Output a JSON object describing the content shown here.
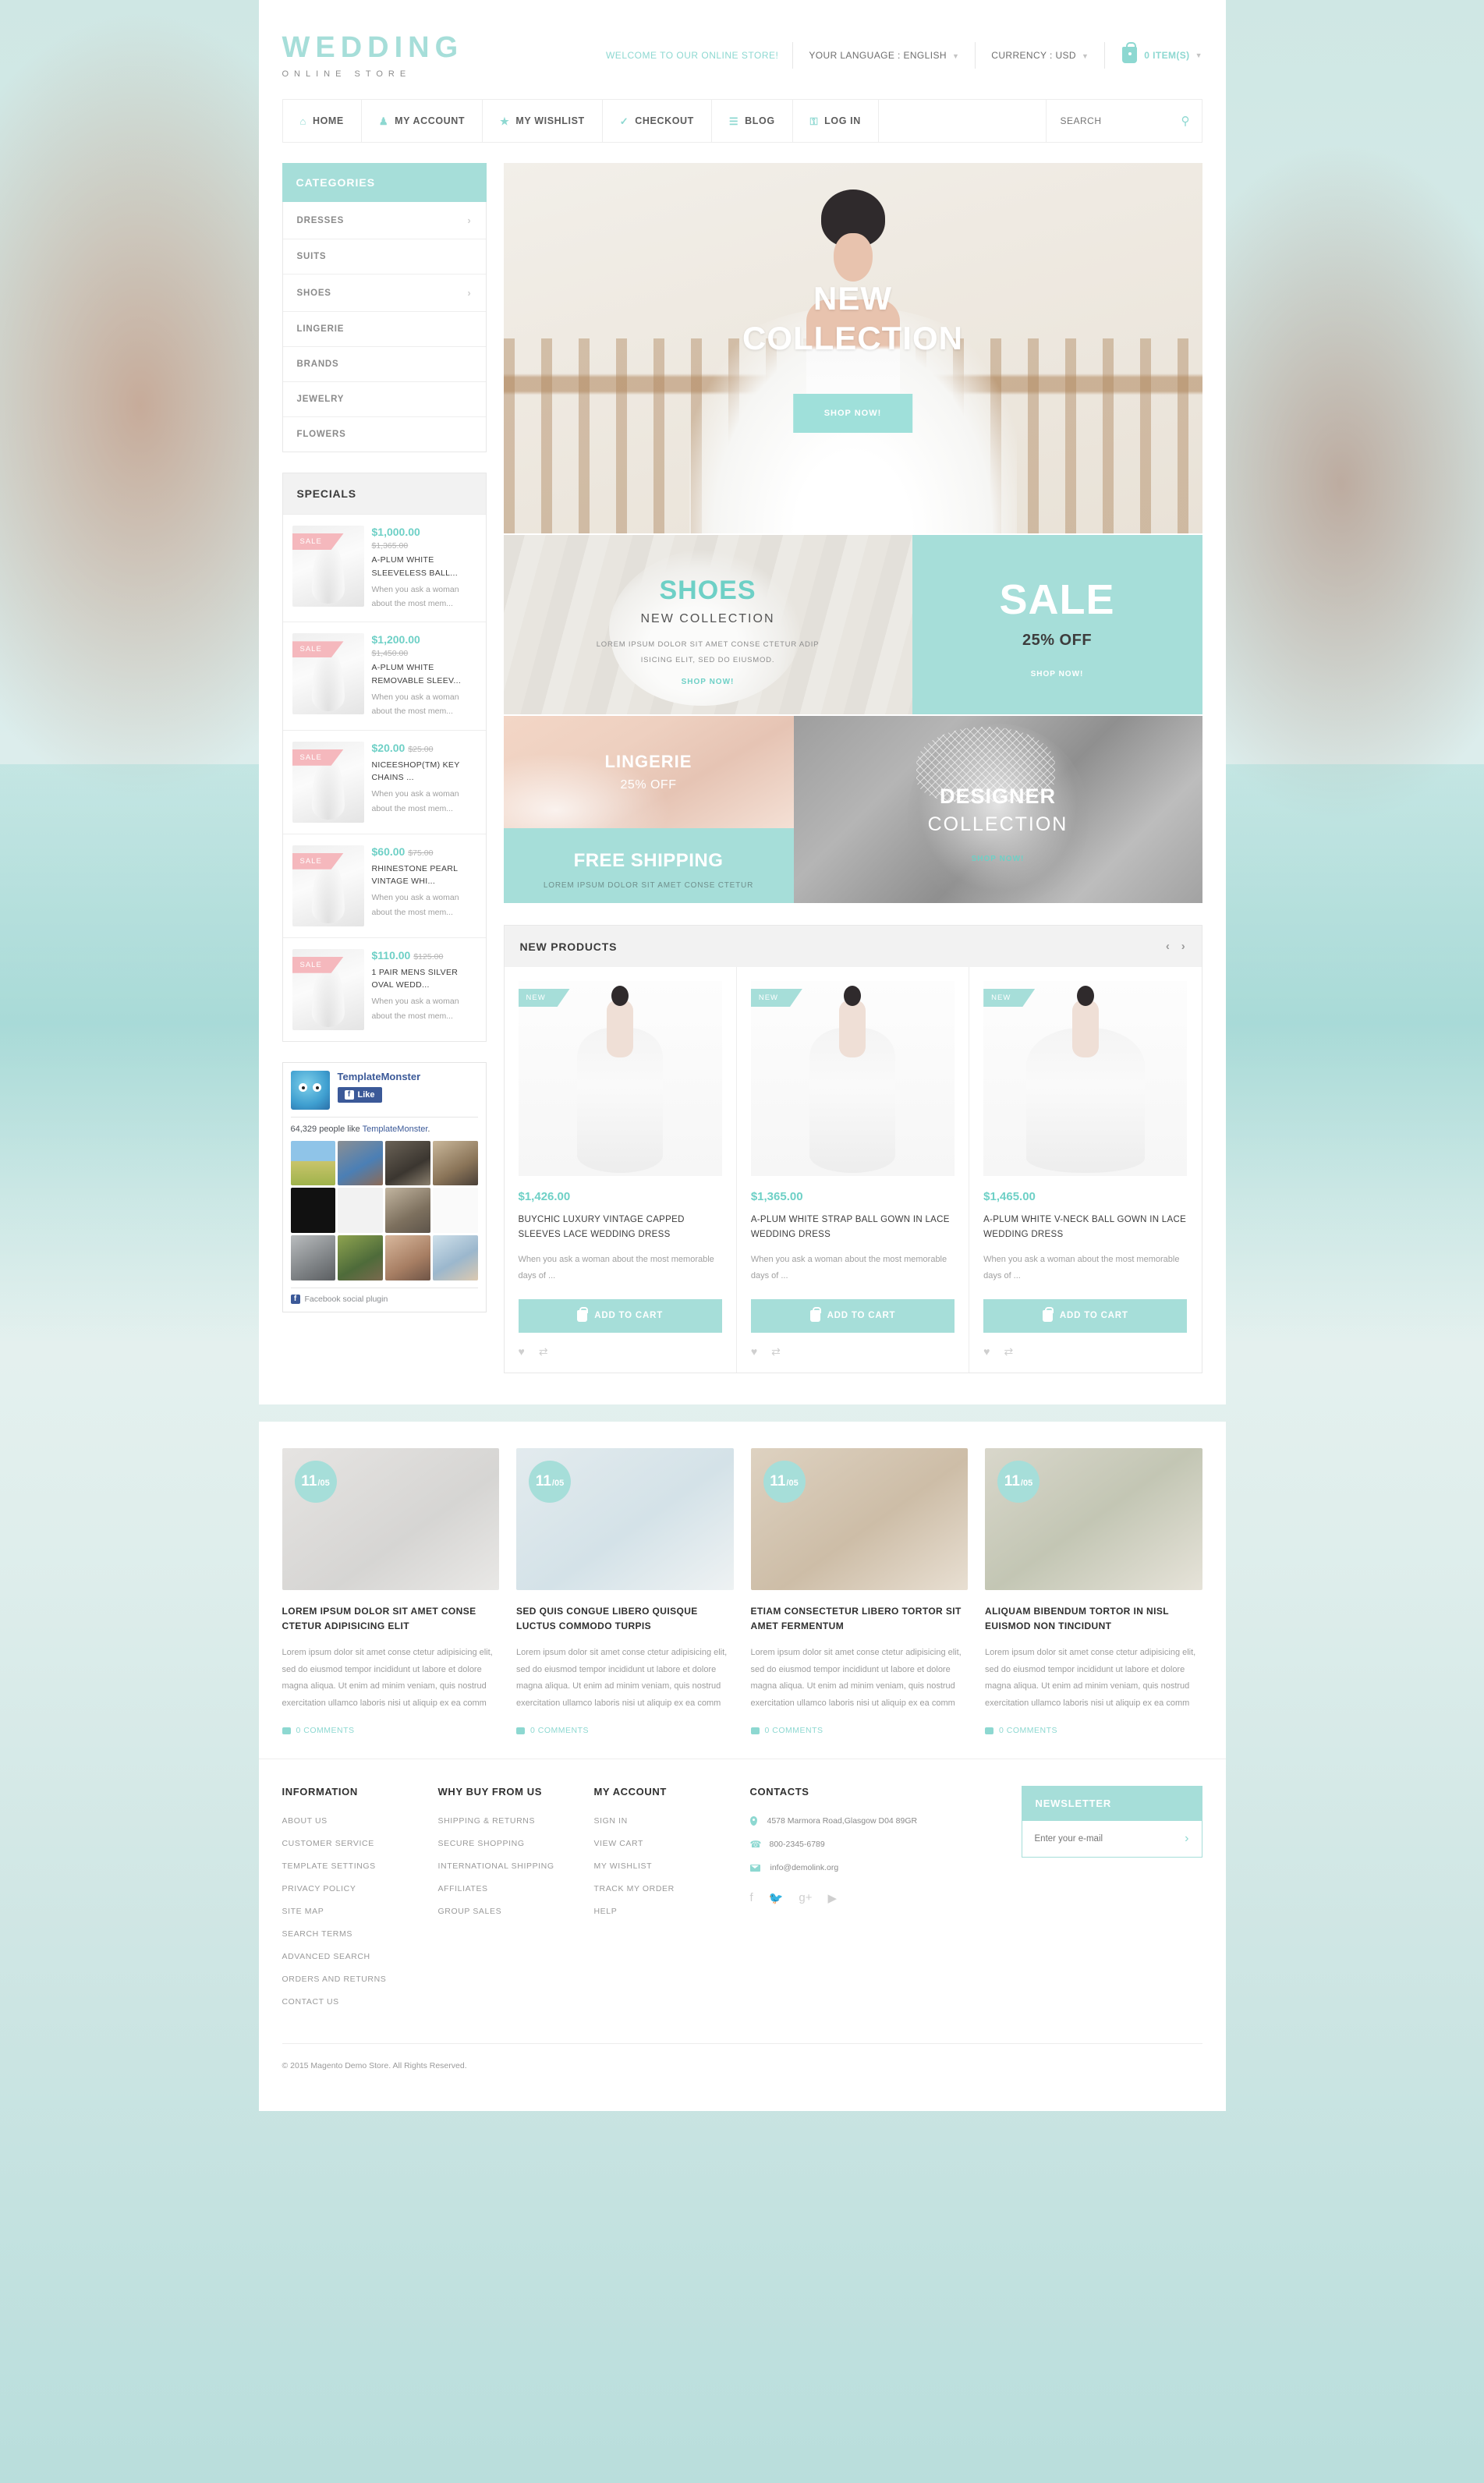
{
  "header": {
    "logo_main": "WEDDING",
    "logo_sub": "ONLINE STORE",
    "welcome": "WELCOME TO OUR ONLINE STORE!",
    "language": "YOUR LANGUAGE : ENGLISH",
    "currency": "CURRENCY : USD",
    "cart": "0 ITEM(S)"
  },
  "nav": {
    "items": [
      {
        "label": "HOME",
        "icon": "home-icon",
        "glyph": "⌂"
      },
      {
        "label": "MY ACCOUNT",
        "icon": "user-icon",
        "glyph": "♟"
      },
      {
        "label": "MY WISHLIST",
        "icon": "star-icon",
        "glyph": "★"
      },
      {
        "label": "CHECKOUT",
        "icon": "check-circle-icon",
        "glyph": "✓"
      },
      {
        "label": "BLOG",
        "icon": "document-icon",
        "glyph": "☰"
      },
      {
        "label": "LOG IN",
        "icon": "lock-icon",
        "glyph": "⚿"
      }
    ],
    "search_placeholder": "SEARCH",
    "search_value": ""
  },
  "sidebar": {
    "categories_title": "CATEGORIES",
    "categories": [
      {
        "label": "DRESSES",
        "has_arrow": true
      },
      {
        "label": "SUITS",
        "has_arrow": false
      },
      {
        "label": "SHOES",
        "has_arrow": true
      },
      {
        "label": "LINGERIE",
        "has_arrow": false
      },
      {
        "label": "BRANDS",
        "has_arrow": false
      },
      {
        "label": "JEWELRY",
        "has_arrow": false
      },
      {
        "label": "FLOWERS",
        "has_arrow": false
      }
    ],
    "specials_title": "SPECIALS",
    "specials_badge": "SALE",
    "specials": [
      {
        "price": "$1,000.00",
        "old_price": "$1,365.00",
        "price_stacked": true,
        "name": "A-PLUM WHITE SLEEVELESS BALL...",
        "desc": "When you ask a woman about the most mem..."
      },
      {
        "price": "$1,200.00",
        "old_price": "$1,450.00",
        "price_stacked": true,
        "name": "A-PLUM WHITE REMOVABLE SLEEV...",
        "desc": "When you ask a woman about the most mem..."
      },
      {
        "price": "$20.00",
        "old_price": "$25.00",
        "price_stacked": false,
        "name": "NICEESHOP(TM) KEY CHAINS ...",
        "desc": "When you ask a woman about the most mem..."
      },
      {
        "price": "$60.00",
        "old_price": "$75.00",
        "price_stacked": false,
        "name": "RHINESTONE PEARL VINTAGE WHI...",
        "desc": "When you ask a woman about the most mem..."
      },
      {
        "price": "$110.00",
        "old_price": "$125.00",
        "price_stacked": false,
        "name": "1 PAIR MENS SILVER OVAL WEDD...",
        "desc": "When you ask a woman about the most mem..."
      }
    ],
    "facebook": {
      "page_name": "TemplateMonster",
      "like_label": "Like",
      "count_text": "64,329 people like ",
      "count_link": "TemplateMonster",
      "count_end": ".",
      "plugin_label": "Facebook social plugin"
    }
  },
  "hero": {
    "line1": "NEW",
    "line2": "COLLECTION",
    "button": "SHOP NOW!"
  },
  "promos": {
    "shoes": {
      "title": "SHOES",
      "subtitle": "NEW COLLECTION",
      "desc_line1": "LOREM IPSUM DOLOR SIT AMET CONSE CTETUR ADIP",
      "desc_line2": "ISICING ELIT, SED DO EIUSMOD.",
      "link": "SHOP NOW!"
    },
    "sale": {
      "title": "SALE",
      "subtitle": "25% OFF",
      "link": "SHOP NOW!"
    },
    "lingerie": {
      "title": "LINGERIE",
      "subtitle": "25% OFF"
    },
    "shipping": {
      "title": "FREE SHIPPING",
      "subtitle": "LOREM IPSUM DOLOR SIT AMET CONSE CTETUR"
    },
    "designer": {
      "line1": "DESIGNER",
      "line2": "COLLECTION",
      "link": "SHOP NOW!"
    }
  },
  "new_products": {
    "title": "NEW PRODUCTS",
    "badge": "NEW",
    "add_to_cart": "ADD TO CART",
    "items": [
      {
        "price": "$1,426.00",
        "name": "BUYCHIC LUXURY VINTAGE CAPPED SLEEVES LACE WEDDING DRESS",
        "desc": "When you ask a woman about the most memorable days of ..."
      },
      {
        "price": "$1,365.00",
        "name": "A-PLUM WHITE STRAP BALL GOWN IN LACE WEDDING DRESS",
        "desc": "When you ask a woman about the most memorable days of ..."
      },
      {
        "price": "$1,465.00",
        "name": "A-PLUM WHITE V-NECK BALL GOWN IN LACE WEDDING DRESS",
        "desc": "When you ask a woman about the most memorable days of ..."
      }
    ]
  },
  "blog": {
    "posts": [
      {
        "day": "11",
        "month": "/05",
        "title": "LOREM IPSUM DOLOR SIT AMET CONSE CTETUR ADIPISICING ELIT",
        "text": "Lorem ipsum dolor sit amet conse ctetur adipisicing elit, sed do eiusmod tempor incididunt ut labore et dolore magna aliqua. Ut enim ad minim veniam, quis nostrud exercitation ullamco laboris nisi ut aliquip ex ea comm",
        "comments": "0 COMMENTS"
      },
      {
        "day": "11",
        "month": "/05",
        "title": "SED QUIS CONGUE LIBERO QUISQUE LUCTUS COMMODO TURPIS",
        "text": "Lorem ipsum dolor sit amet conse ctetur adipisicing elit, sed do eiusmod tempor incididunt ut labore et dolore magna aliqua. Ut enim ad minim veniam, quis nostrud exercitation ullamco laboris nisi ut aliquip ex ea comm",
        "comments": "0 COMMENTS"
      },
      {
        "day": "11",
        "month": "/05",
        "title": "ETIAM CONSECTETUR LIBERO TORTOR SIT AMET FERMENTUM",
        "text": "Lorem ipsum dolor sit amet conse ctetur adipisicing elit, sed do eiusmod tempor incididunt ut labore et dolore magna aliqua. Ut enim ad minim veniam, quis nostrud exercitation ullamco laboris nisi ut aliquip ex ea comm",
        "comments": "0 COMMENTS"
      },
      {
        "day": "11",
        "month": "/05",
        "title": "ALIQUAM BIBENDUM TORTOR IN NISL EUISMOD NON TINCIDUNT",
        "text": "Lorem ipsum dolor sit amet conse ctetur adipisicing elit, sed do eiusmod tempor incididunt ut labore et dolore magna aliqua. Ut enim ad minim veniam, quis nostrud exercitation ullamco laboris nisi ut aliquip ex ea comm",
        "comments": "0 COMMENTS"
      }
    ]
  },
  "footer": {
    "information": {
      "title": "INFORMATION",
      "links": [
        "ABOUT US",
        "CUSTOMER SERVICE",
        "TEMPLATE SETTINGS",
        "PRIVACY POLICY",
        "SITE MAP",
        "SEARCH TERMS",
        "ADVANCED SEARCH",
        "ORDERS AND RETURNS",
        "CONTACT US"
      ]
    },
    "why_buy": {
      "title": "WHY BUY FROM US",
      "links": [
        "SHIPPING & RETURNS",
        "SECURE SHOPPING",
        "INTERNATIONAL SHIPPING",
        "AFFILIATES",
        "GROUP SALES"
      ]
    },
    "my_account": {
      "title": "MY ACCOUNT",
      "links": [
        "SIGN IN",
        "VIEW CART",
        "MY WISHLIST",
        "TRACK MY ORDER",
        "HELP"
      ]
    },
    "contacts": {
      "title": "CONTACTS",
      "address": "4578 Marmora Road,Glasgow D04 89GR",
      "phone": "800-2345-6789",
      "email": "info@demolink.org",
      "socials": [
        "f",
        "ᴛ",
        "g+",
        "▶"
      ]
    },
    "newsletter": {
      "title": "NEWSLETTER",
      "placeholder": "Enter your e-mail",
      "value": ""
    },
    "copyright": "© 2015 Magento Demo Store. All Rights Reserved."
  },
  "colors": {
    "accent": "#a6ded9",
    "accent_text": "#6ed0c6",
    "sale_pink": "#f5b8bd"
  }
}
